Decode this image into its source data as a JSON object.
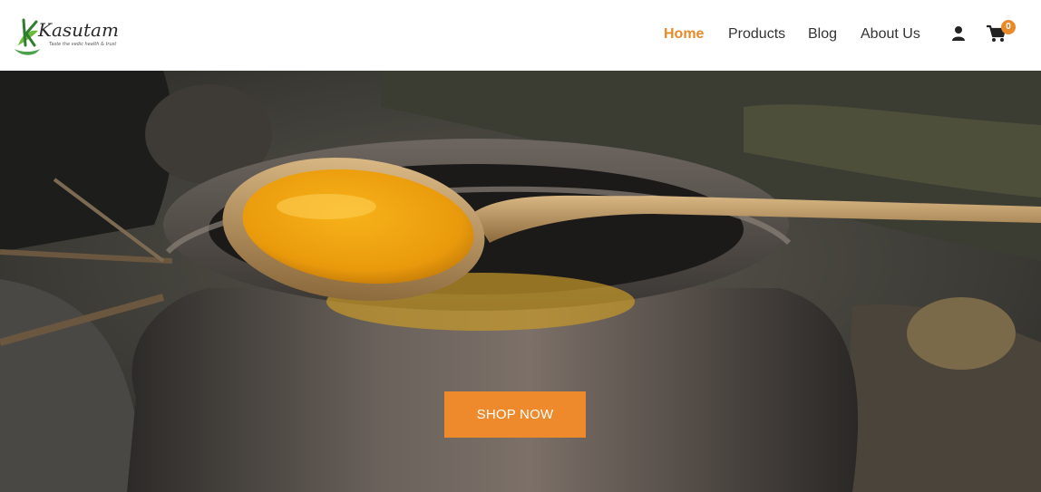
{
  "brand": {
    "logo_text": "Kasutam",
    "tagline": "Taste the vedic health & trust",
    "accent_color": "#e8892a",
    "leaf_color": "#4aa34a"
  },
  "nav": {
    "items": [
      {
        "label": "Home",
        "active": true
      },
      {
        "label": "Products",
        "active": false
      },
      {
        "label": "Blog",
        "active": false
      },
      {
        "label": "About Us",
        "active": false
      }
    ],
    "user_icon": "user-icon",
    "cart_icon": "cart-icon",
    "cart_count": "0"
  },
  "hero": {
    "description": "",
    "cta_label": "SHOP NOW",
    "cta_color": "#ee8a2c"
  }
}
